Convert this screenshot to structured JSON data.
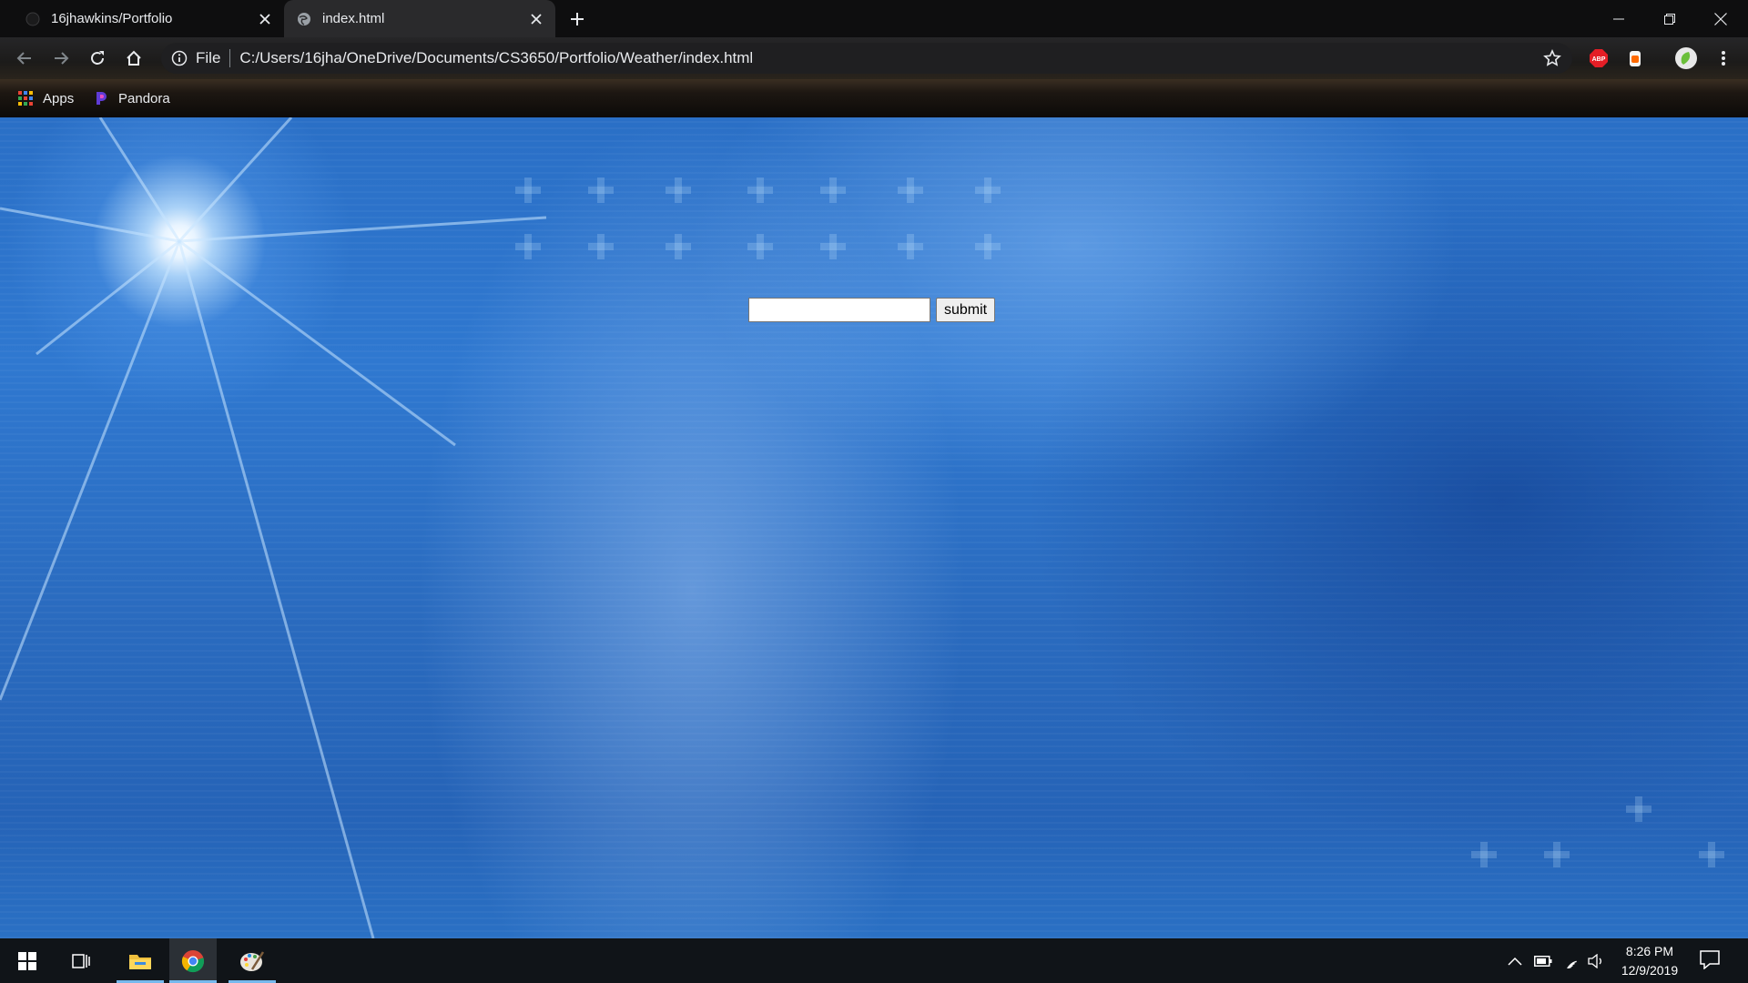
{
  "browser": {
    "tabs": [
      {
        "title": "16jhawkins/Portfolio",
        "active": false,
        "icon": "github-icon"
      },
      {
        "title": "index.html",
        "active": true,
        "icon": "globe-icon"
      }
    ],
    "omnibox": {
      "scheme_label": "File",
      "url": "C:/Users/16jha/OneDrive/Documents/CS3650/Portfolio/Weather/index.html"
    },
    "extensions": [
      "adblock-plus-icon",
      "extension-icon",
      "profile-avatar"
    ],
    "bookmarks": [
      {
        "label": "Apps",
        "icon": "apps-grid-icon"
      },
      {
        "label": "Pandora",
        "icon": "pandora-icon"
      }
    ]
  },
  "page": {
    "city_input": {
      "value": "",
      "placeholder": ""
    },
    "submit_label": "submit",
    "colors": {
      "sky_top": "#2a6fc6",
      "sky_bottom": "#2563b7"
    }
  },
  "taskbar": {
    "apps": [
      "start-icon",
      "task-view-icon",
      "file-explorer-icon",
      "chrome-icon",
      "paint-icon"
    ],
    "clock": {
      "time": "8:26 PM",
      "date": "12/9/2019"
    }
  }
}
